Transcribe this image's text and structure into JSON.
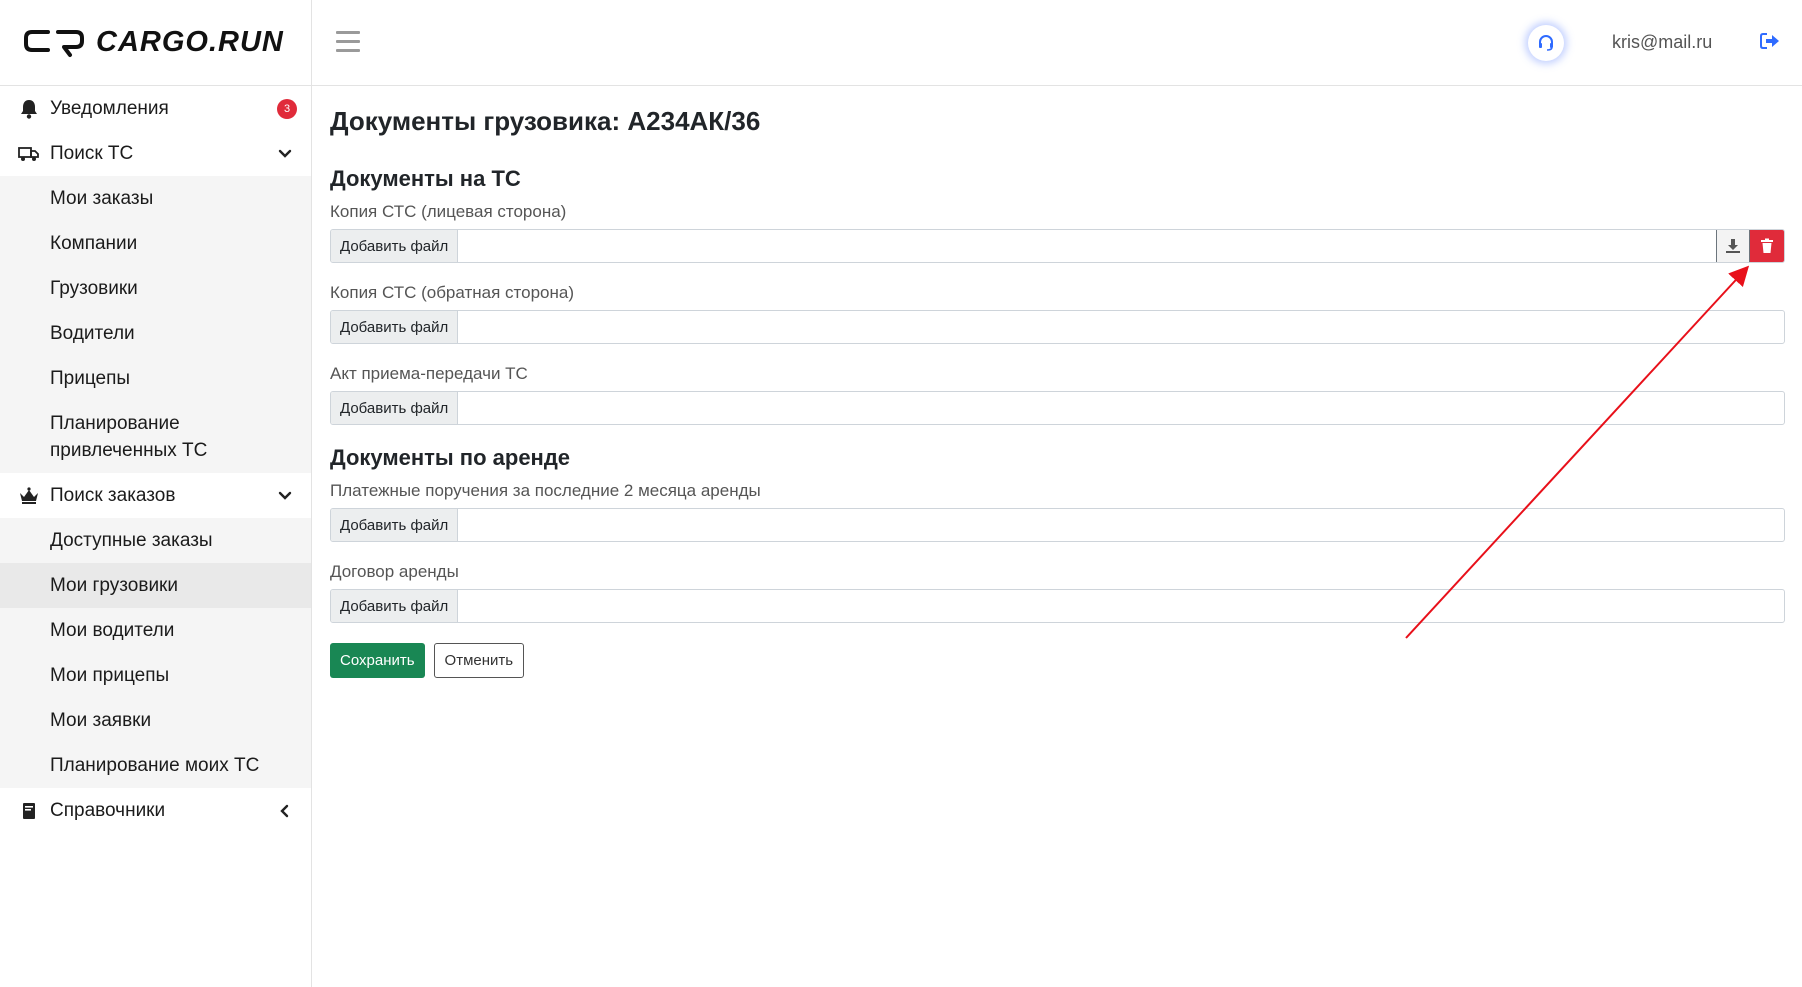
{
  "brand": {
    "name": "CARGO.RUN"
  },
  "sidebar": {
    "notifications": {
      "label": "Уведомления",
      "badge": "3",
      "icon": "bell-icon"
    },
    "search_vehicle": {
      "label": "Поиск ТС",
      "icon": "truck-icon",
      "items": [
        "Мои заказы",
        "Компании",
        "Грузовики",
        "Водители",
        "Прицепы",
        "Планирование привлеченных ТС"
      ]
    },
    "search_orders": {
      "label": "Поиск заказов",
      "icon": "crown-icon",
      "items": [
        "Доступные заказы",
        "Мои грузовики",
        "Мои водители",
        "Мои прицепы",
        "Мои заявки",
        "Планирование моих ТС"
      ],
      "active": "Мои грузовики"
    },
    "directories": {
      "label": "Справочники",
      "icon": "book-icon"
    }
  },
  "header": {
    "user_email": "kris@mail.ru"
  },
  "main": {
    "title": "Документы грузовика: А234АК/36",
    "sections": [
      {
        "title": "Документы на ТС",
        "fields": [
          {
            "label": "Копия СТС (лицевая сторона)",
            "button": "Добавить файл",
            "has_file": true
          },
          {
            "label": "Копия СТС (обратная сторона)",
            "button": "Добавить файл",
            "has_file": false
          },
          {
            "label": "Акт приема-передачи ТС",
            "button": "Добавить файл",
            "has_file": false
          }
        ]
      },
      {
        "title": "Документы по аренде",
        "fields": [
          {
            "label": "Платежные поручения за последние 2 месяца аренды",
            "button": "Добавить файл",
            "has_file": false
          },
          {
            "label": "Договор аренды",
            "button": "Добавить файл",
            "has_file": false
          }
        ]
      }
    ],
    "save_label": "Сохранить",
    "cancel_label": "Отменить"
  },
  "colors": {
    "accent_green": "#198754",
    "danger_red": "#e02b3a",
    "annotation_red": "#e8101a"
  }
}
